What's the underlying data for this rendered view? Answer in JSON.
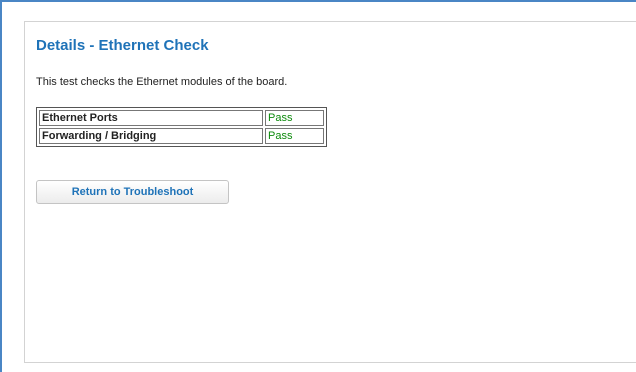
{
  "page": {
    "title": "Details - Ethernet Check",
    "description": "This test checks the Ethernet modules of the board."
  },
  "results": [
    {
      "name": "Ethernet Ports",
      "status": "Pass"
    },
    {
      "name": "Forwarding / Bridging",
      "status": "Pass"
    }
  ],
  "actions": {
    "return_label": "Return to Troubleshoot"
  },
  "colors": {
    "accent": "#1f73b8",
    "pass": "#0d8a0d",
    "frame_border": "#4a86c5"
  }
}
